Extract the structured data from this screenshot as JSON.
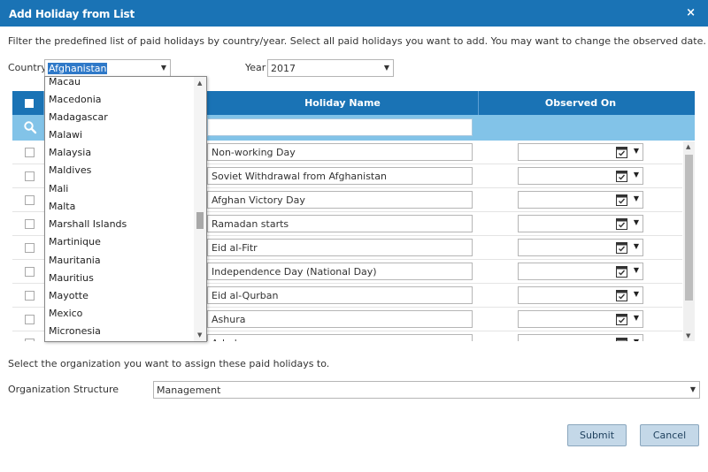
{
  "dialog": {
    "title": "Add Holiday from List",
    "close_label": "×",
    "instructions": "Filter the predefined list of paid holidays by country/year. Select all paid holidays you want to add. You may want to change the observed date."
  },
  "filters": {
    "country_label": "Country",
    "country_value": "Afghanistan",
    "year_label": "Year",
    "year_value": "2017"
  },
  "grid": {
    "columns": {
      "holiday_name": "Holiday Name",
      "observed_on": "Observed On"
    },
    "search_value": "",
    "rows": [
      {
        "name": "Non-working Day",
        "observed": ""
      },
      {
        "name": "Soviet Withdrawal from Afghanistan",
        "observed": ""
      },
      {
        "name": "Afghan Victory Day",
        "observed": ""
      },
      {
        "name": "Ramadan starts",
        "observed": ""
      },
      {
        "name": "Eid al-Fitr",
        "observed": ""
      },
      {
        "name": "Independence Day (National Day)",
        "observed": ""
      },
      {
        "name": "Eid al-Qurban",
        "observed": ""
      },
      {
        "name": "Ashura",
        "observed": ""
      },
      {
        "name": "Arba'een",
        "observed": ""
      }
    ]
  },
  "country_dropdown": {
    "options": [
      "Macau",
      "Macedonia",
      "Madagascar",
      "Malawi",
      "Malaysia",
      "Maldives",
      "Mali",
      "Malta",
      "Marshall Islands",
      "Martinique",
      "Mauritania",
      "Mauritius",
      "Mayotte",
      "Mexico",
      "Micronesia"
    ]
  },
  "organization": {
    "prompt": "Select the organization you want to assign these paid holidays to.",
    "label": "Organization Structure",
    "value": "Management"
  },
  "buttons": {
    "submit": "Submit",
    "cancel": "Cancel"
  },
  "colors": {
    "header_blue": "#1a73b5",
    "filter_row": "#82c3e8",
    "button_bg": "#c4d8e8",
    "selection": "#2f79c8"
  }
}
